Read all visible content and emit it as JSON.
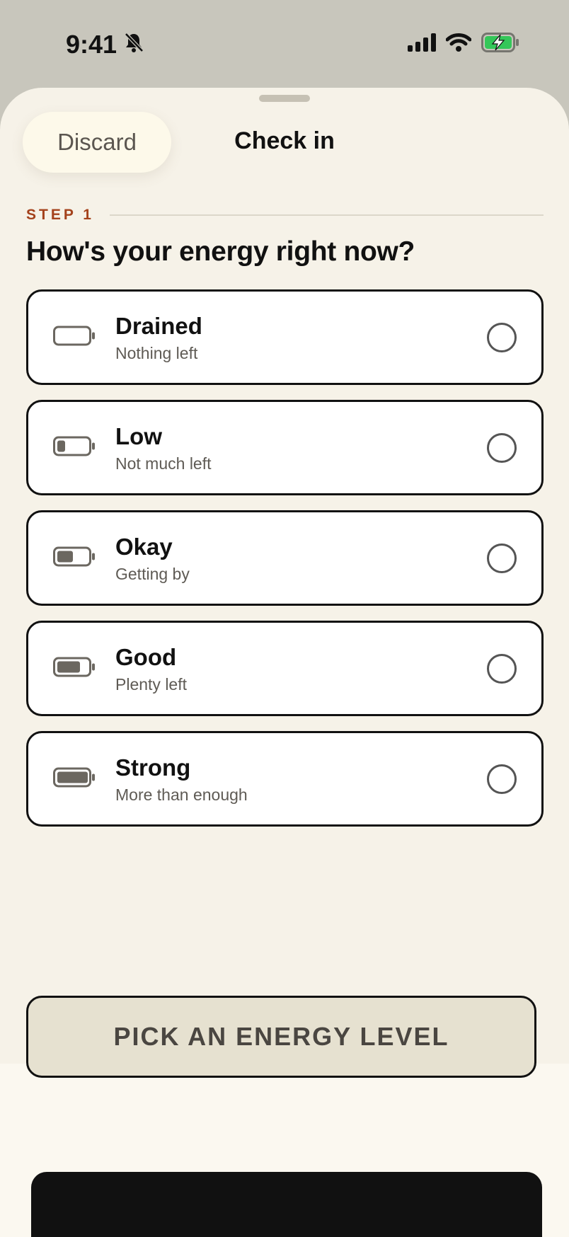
{
  "status_bar": {
    "time": "9:41",
    "icons": [
      "bell-slash-icon",
      "cellular-signal-icon",
      "wifi-icon",
      "battery-charging-icon"
    ],
    "battery_color": "#34c759"
  },
  "header": {
    "discard_label": "Discard",
    "title": "Check in"
  },
  "step": {
    "label": "STEP 1",
    "question": "How's your energy right now?"
  },
  "options": [
    {
      "label": "Drained",
      "sub": "Nothing left",
      "icon": "battery-empty-icon",
      "level": 0
    },
    {
      "label": "Low",
      "sub": "Not much left",
      "icon": "battery-low-icon",
      "level": 0.25
    },
    {
      "label": "Okay",
      "sub": "Getting by",
      "icon": "battery-medium-icon",
      "level": 0.5
    },
    {
      "label": "Good",
      "sub": "Plenty left",
      "icon": "battery-high-icon",
      "level": 0.75
    },
    {
      "label": "Strong",
      "sub": "More than enough",
      "icon": "battery-full-icon",
      "level": 1
    }
  ],
  "cta": {
    "label": "PICK AN ENERGY LEVEL"
  },
  "colors": {
    "accent": "#a4421c",
    "sheet_bg": "#f6f2e8",
    "cta_bg": "#e6e1d0"
  }
}
